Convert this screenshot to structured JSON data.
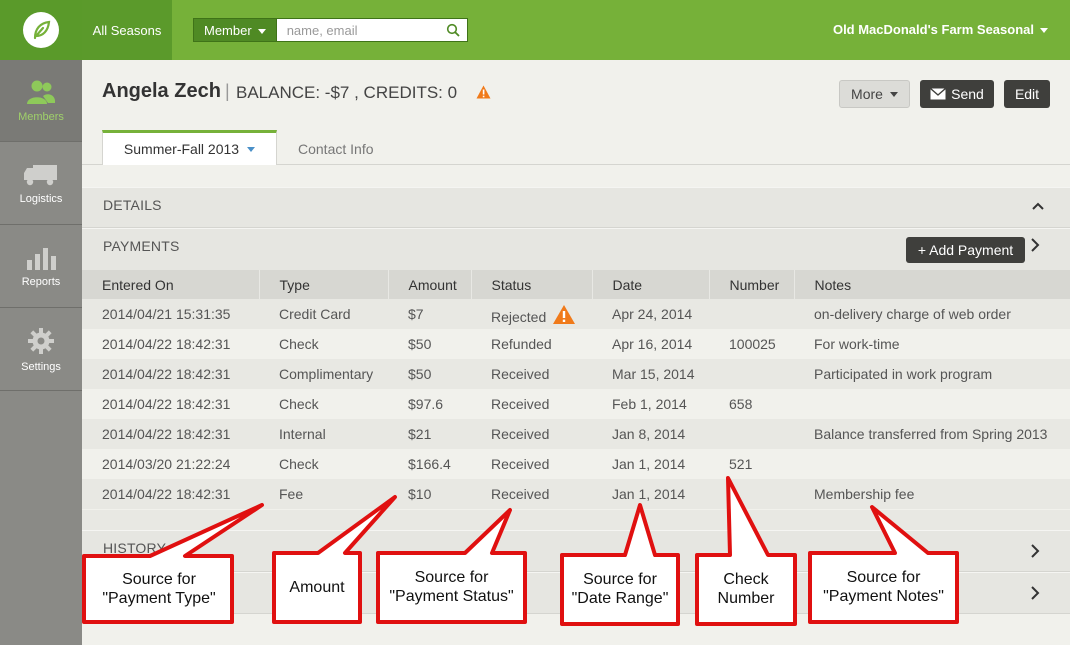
{
  "topbar": {
    "seasons_label": "All Seasons",
    "search_scope": "Member",
    "search_placeholder": "name, email",
    "farm_name": "Old MacDonald's Farm Seasonal"
  },
  "sidebar": {
    "items": [
      {
        "label": "Members",
        "icon": "members-icon",
        "active": true
      },
      {
        "label": "Logistics",
        "icon": "truck-icon",
        "active": false
      },
      {
        "label": "Reports",
        "icon": "bar-chart-icon",
        "active": false
      },
      {
        "label": "Settings",
        "icon": "gear-icon",
        "active": false
      }
    ]
  },
  "member": {
    "name": "Angela Zech",
    "separator": "|",
    "balance_text": "BALANCE: -$7 ,  CREDITS: 0"
  },
  "actions": {
    "more": "More",
    "send": "Send",
    "edit": "Edit"
  },
  "tabs": [
    {
      "label": "Summer-Fall 2013"
    },
    {
      "label": "Contact Info"
    }
  ],
  "sections": {
    "details": "DETAILS",
    "payments": "PAYMENTS",
    "history": "HISTORY",
    "add_payment": "+ Add Payment"
  },
  "payments": {
    "columns": [
      "Entered On",
      "Type",
      "Amount",
      "Status",
      "Date",
      "Number",
      "Notes"
    ],
    "rows": [
      {
        "entered": "2014/04/21 15:31:35",
        "type": "Credit Card",
        "amount": "$7",
        "status": "Rejected",
        "warn": true,
        "date": "Apr 24, 2014",
        "number": "",
        "notes": "on-delivery charge of web order"
      },
      {
        "entered": "2014/04/22 18:42:31",
        "type": "Check",
        "amount": "$50",
        "status": "Refunded",
        "warn": false,
        "date": "Apr 16, 2014",
        "number": "100025",
        "notes": "For work-time"
      },
      {
        "entered": "2014/04/22 18:42:31",
        "type": "Complimentary",
        "amount": "$50",
        "status": "Received",
        "warn": false,
        "date": "Mar 15, 2014",
        "number": "",
        "notes": "Participated in work program"
      },
      {
        "entered": "2014/04/22 18:42:31",
        "type": "Check",
        "amount": "$97.6",
        "status": "Received",
        "warn": false,
        "date": "Feb 1, 2014",
        "number": "658",
        "notes": ""
      },
      {
        "entered": "2014/04/22 18:42:31",
        "type": "Internal",
        "amount": "$21",
        "status": "Received",
        "warn": false,
        "date": "Jan 8, 2014",
        "number": "",
        "notes": "Balance transferred from Spring 2013"
      },
      {
        "entered": "2014/03/20 21:22:24",
        "type": "Check",
        "amount": "$166.4",
        "status": "Received",
        "warn": false,
        "date": "Jan 1, 2014",
        "number": "521",
        "notes": ""
      },
      {
        "entered": "2014/04/22 18:42:31",
        "type": "Fee",
        "amount": "$10",
        "status": "Received",
        "warn": false,
        "date": "Jan 1, 2014",
        "number": "",
        "notes": "Membership fee"
      }
    ]
  },
  "callouts": [
    {
      "text": "Source for \"Payment Type\""
    },
    {
      "text": "Amount"
    },
    {
      "text": "Source for \"Payment Status\""
    },
    {
      "text": "Source for \"Date Range\""
    },
    {
      "text": "Check Number"
    },
    {
      "text": "Source for \"Payment Notes\""
    }
  ],
  "colors": {
    "brand_green": "#76b139",
    "callout_red": "#e01010",
    "warning_orange": "#f07a1a"
  }
}
